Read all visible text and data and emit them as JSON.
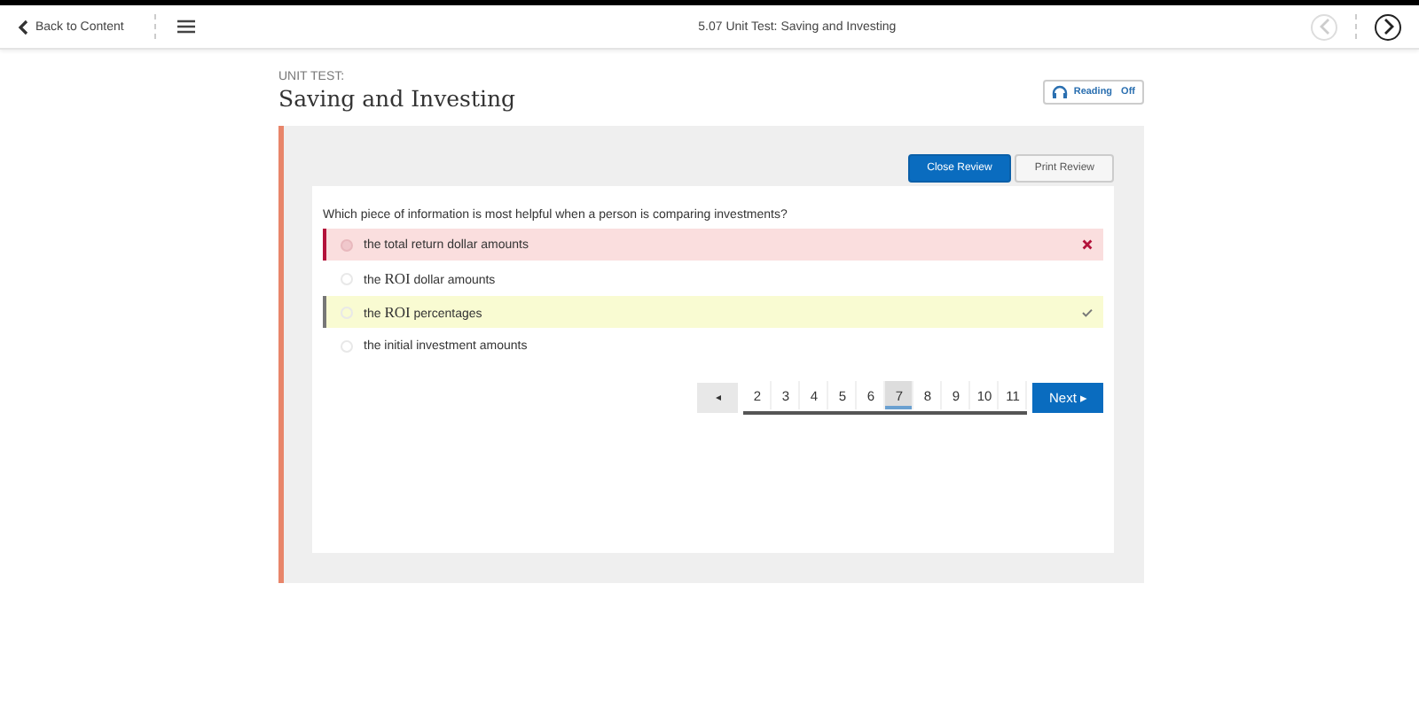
{
  "topbar": {
    "back": "Back to Content",
    "title": "5.07 Unit Test: Saving and Investing",
    "prev_disabled": true
  },
  "header": {
    "eyebrow": "UNIT TEST:",
    "title": "Saving and Investing",
    "reading": {
      "label": "Reading",
      "state": "Off"
    }
  },
  "buttons": [
    {
      "label": "Close Review",
      "primary": true
    },
    {
      "label": "Print Review",
      "primary": false
    }
  ],
  "question": "Which piece of information is most helpful when a person is comparing investments?",
  "options": [
    {
      "chosen": true,
      "correct": false,
      "parts": [
        {
          "text": "the total return dollar amounts",
          "serif": false
        }
      ]
    },
    {
      "chosen": false,
      "correct": false,
      "parts": [
        {
          "text": "the ",
          "serif": false
        },
        {
          "text": "ROI",
          "serif": true
        },
        {
          "text": " dollar amounts",
          "serif": false
        }
      ]
    },
    {
      "chosen": false,
      "correct": true,
      "parts": [
        {
          "text": "the ",
          "serif": false
        },
        {
          "text": "ROI",
          "serif": true
        },
        {
          "text": " percentages",
          "serif": false
        }
      ]
    },
    {
      "chosen": false,
      "correct": false,
      "parts": [
        {
          "text": "the initial investment amounts",
          "serif": false
        }
      ]
    }
  ],
  "pager": {
    "prev": "◂",
    "pages": [
      {
        "label": "2",
        "selected": false
      },
      {
        "label": "3",
        "selected": false
      },
      {
        "label": "4",
        "selected": false
      },
      {
        "label": "5",
        "selected": false
      },
      {
        "label": "6",
        "selected": false
      },
      {
        "label": "7",
        "selected": true
      },
      {
        "label": "8",
        "selected": false
      },
      {
        "label": "9",
        "selected": false
      },
      {
        "label": "10",
        "selected": false
      },
      {
        "label": "11",
        "selected": false
      }
    ],
    "next": "Next ▸"
  }
}
